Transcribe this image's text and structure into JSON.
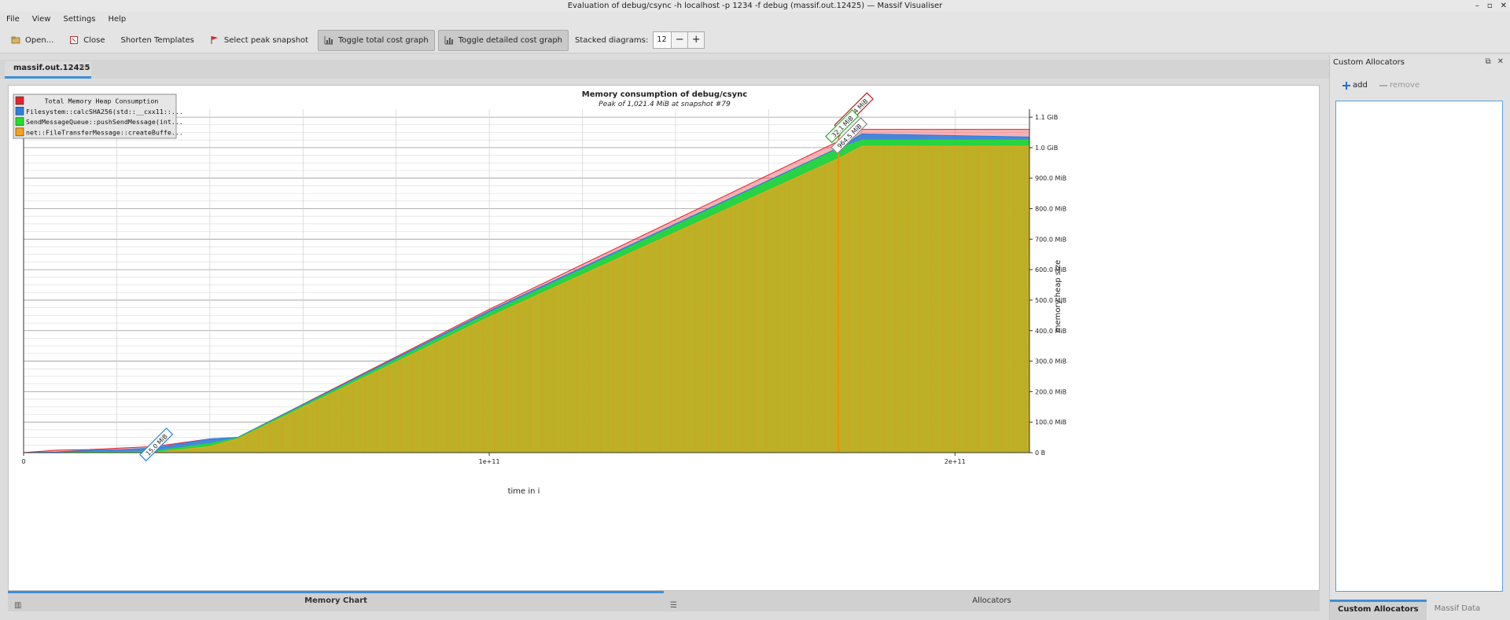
{
  "window": {
    "title": "Evaluation of debug/csync -h localhost -p 1234 -f debug (massif.out.12425) — Massif Visualiser",
    "controls": [
      "–",
      "▫",
      "✕"
    ]
  },
  "menu": [
    "File",
    "View",
    "Settings",
    "Help"
  ],
  "toolbar": {
    "open": "Open...",
    "close": "Close",
    "shorten": "Shorten Templates",
    "peak": "Select peak snapshot",
    "toggle_total": "Toggle total cost graph",
    "toggle_detailed": "Toggle detailed cost graph",
    "stacked_label": "Stacked diagrams:",
    "stacked_value": "12",
    "minus": "−",
    "plus": "+"
  },
  "tab": {
    "label": "massif.out.12425",
    "close": "✕"
  },
  "chart": {
    "title": "Memory consumption of debug/csync",
    "subtitle": "Peak of 1,021.4 MiB at snapshot #79",
    "xlabel": "time in i",
    "ylabel": "memory heap size",
    "x_ticks": [
      "0",
      "1e+11",
      "2e+11"
    ],
    "y_ticks": [
      "0 B",
      "100.0 MiB",
      "200.0 MiB",
      "300.0 MiB",
      "400.0 MiB",
      "500.0 MiB",
      "600.0 MiB",
      "700.0 MiB",
      "800.0 MiB",
      "900.0 MiB",
      "1.0 GiB",
      "1.1 GiB"
    ],
    "legend": [
      {
        "label": "Total Memory Heap Consumption",
        "color": "#e8202a"
      },
      {
        "label": "Filesystem::calcSHA256(std::__cxx11::...",
        "color": "#2a7fe0"
      },
      {
        "label": "SendMessageQueue::pushSendMessage(int...",
        "color": "#22e02a"
      },
      {
        "label": "net::FileTransferMessage::createBuffe...",
        "color": "#f7a21a"
      }
    ],
    "annotations": {
      "peak_total": "1021.4 MiB",
      "peak_green": "32.1 MiB",
      "peak_orange": "964.5 MiB",
      "early_blue": "15.0 MiB"
    }
  },
  "chart_data": {
    "type": "area",
    "title": "Memory consumption of debug/csync",
    "subtitle": "Peak of 1,021.4 MiB at snapshot #79",
    "xlabel": "time in i",
    "ylabel": "memory heap size",
    "xlim": [
      0,
      216000000000
    ],
    "ylim_mib": [
      0,
      1126
    ],
    "x": [
      0,
      7000000000,
      14000000000,
      21000000000,
      28000000000,
      40000000000,
      46000000000,
      100000000000,
      175000000000,
      180000000000,
      216000000000
    ],
    "series": [
      {
        "name": "Total Memory Heap Consumption",
        "values": [
          0,
          8,
          10,
          15,
          20,
          45,
          50,
          470,
          1021.4,
          1060,
          1060
        ]
      },
      {
        "name": "Filesystem::calcSHA256(std::__cxx11::...",
        "values": [
          0,
          2,
          8,
          10,
          15,
          45,
          50,
          465,
          1000,
          1045,
          1035
        ]
      },
      {
        "name": "SendMessageQueue::pushSendMessage(int...",
        "values": [
          0,
          0,
          2,
          3,
          5,
          30,
          48,
          458,
          996.6,
          1025,
          1025
        ]
      },
      {
        "name": "net::FileTransferMessage::createBuffe...",
        "values": [
          0,
          0,
          0,
          0,
          0,
          20,
          45,
          445,
          964.5,
          1005,
          1005
        ]
      }
    ],
    "colors": {
      "total": "#e8202a",
      "blue": "#2a7fe0",
      "green": "#22e02a",
      "orange": "#f7a21a"
    },
    "grid": true,
    "legend": "top-left"
  },
  "bottom_tabs": {
    "memory_chart": "Memory Chart",
    "allocators": "Allocators"
  },
  "right_panel": {
    "title": "Custom Allocators",
    "add": "add",
    "remove": "remove",
    "tabs": [
      "Custom Allocators",
      "Massif Data"
    ]
  }
}
